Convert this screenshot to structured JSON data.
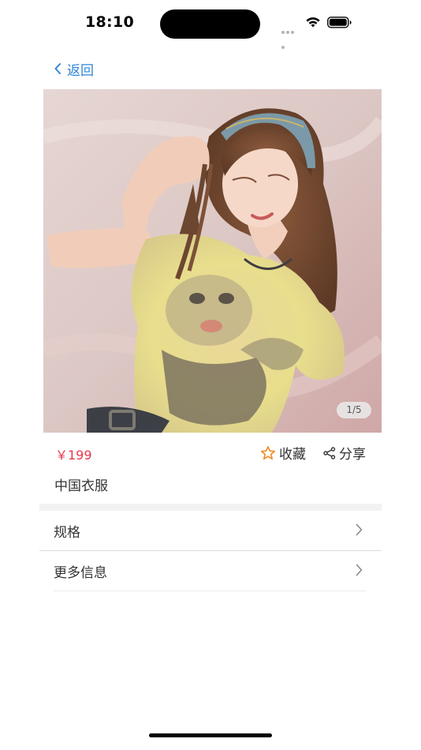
{
  "status_bar": {
    "time": "18:10"
  },
  "nav": {
    "back_label": "返回"
  },
  "product": {
    "image_counter": "1/5",
    "price": "￥199",
    "name": "中国衣服",
    "favorite_label": "收藏",
    "share_label": "分享"
  },
  "rows": [
    {
      "label": "规格"
    },
    {
      "label": "更多信息"
    }
  ],
  "colors": {
    "accent_blue": "#2f86d6",
    "price_red": "#e8384a",
    "favorite_orange": "#f08a24"
  },
  "icons": {
    "back": "chevron-left-icon",
    "favorite": "star-icon",
    "share": "share-icon",
    "row": "chevron-right-icon"
  }
}
